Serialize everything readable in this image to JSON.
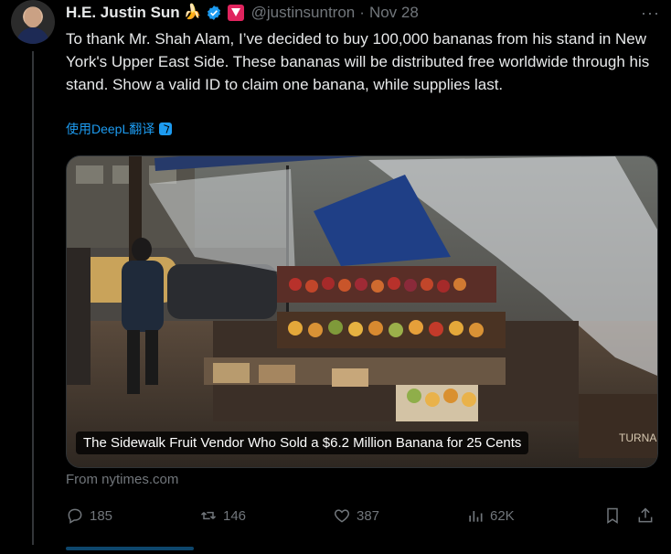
{
  "tweet": {
    "author_name": "H.E. Justin Sun",
    "author_emoji": "🍌",
    "handle": "@justinsuntron",
    "separator": "·",
    "date": "Nov 28",
    "more_label": "···",
    "text": "To thank Mr. Shah Alam, I’ve decided to buy 100,000 bananas from his stand in New York's Upper East Side. These bananas will be distributed free worldwide through his stand. Show a valid ID to claim one banana, while supplies last.",
    "translate_label": "使用DeepL翻译"
  },
  "card": {
    "caption": "The Sidewalk Fruit Vendor Who Sold a $6.2 Million Banana for 25 Cents",
    "awning_text": "TURNA",
    "source": "From nytimes.com"
  },
  "actions": {
    "replies": "185",
    "retweets": "146",
    "likes": "387",
    "views": "62K"
  },
  "colors": {
    "background": "#000000",
    "text": "#e7e9ea",
    "muted": "#71767b",
    "accent": "#1d9bf0"
  }
}
